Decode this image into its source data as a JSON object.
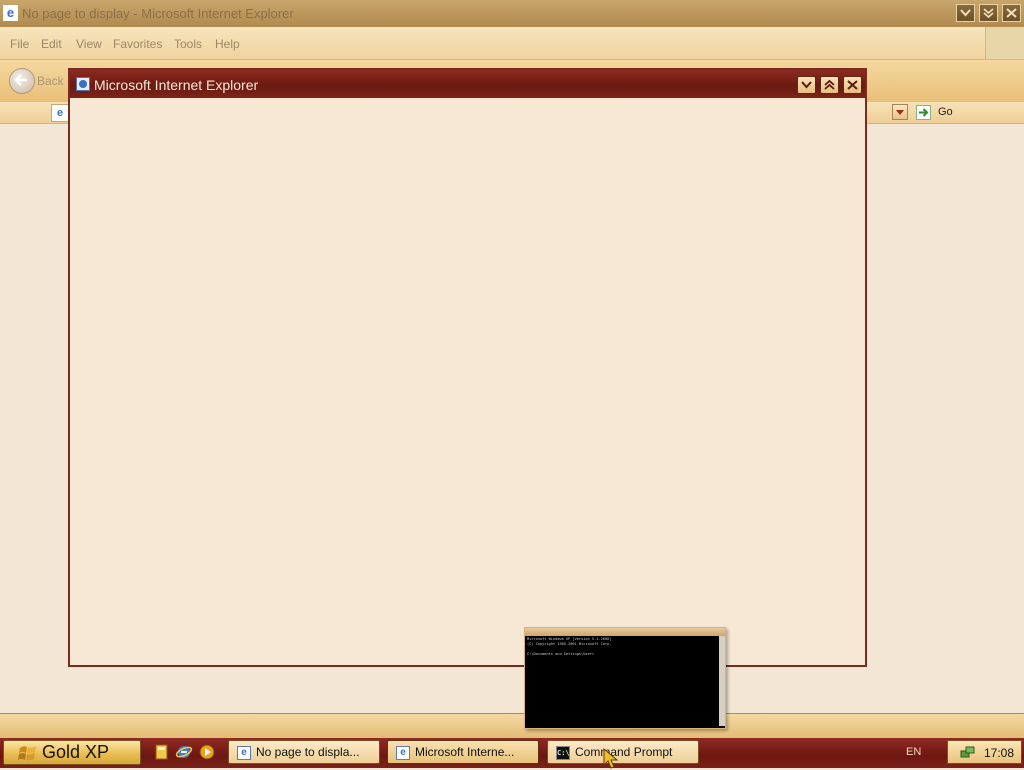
{
  "background_window": {
    "title": "No page to display - Microsoft Internet Explorer",
    "menu": [
      "File",
      "Edit",
      "View",
      "Favorites",
      "Tools",
      "Help"
    ],
    "back_label": "Back",
    "go_label": "Go"
  },
  "dialog": {
    "title": "Microsoft Internet Explorer"
  },
  "cmd_thumbnail": {
    "lines": [
      "Microsoft Windows XP [Version 5.1.2600]",
      "(C) Copyright 1985-2001 Microsoft Corp.",
      "",
      "C:\\Documents and Settings\\User>"
    ]
  },
  "taskbar": {
    "start_label": "Gold XP",
    "tasks": [
      {
        "label": "No page to displa..."
      },
      {
        "label": "Microsoft Interne..."
      },
      {
        "label": "Command Prompt"
      }
    ],
    "language": "EN",
    "clock": "17:08"
  },
  "colors": {
    "title_active": "#7a2418",
    "taskbar": "#7d211a",
    "desktop": "#f4e6d4",
    "start_button": "#e8bf55"
  }
}
